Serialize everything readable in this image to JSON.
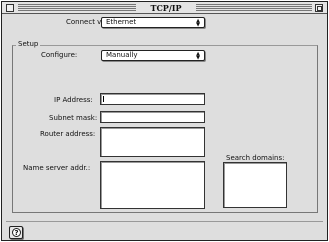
{
  "window": {
    "title": "TCP/IP"
  },
  "connect": {
    "label": "Connect via:",
    "value": "Ethernet"
  },
  "setup": {
    "group_label": "Setup",
    "configure_label": "Configure:",
    "configure_value": "Manually",
    "ip_label": "IP Address:",
    "ip_value": "",
    "subnet_label": "Subnet mask:",
    "subnet_value": "",
    "router_label": "Router address:",
    "router_value": "",
    "nameserver_label": "Name server addr.:",
    "nameserver_value": "",
    "search_domains_label": "Search domains:",
    "search_domains_value": ""
  },
  "footer": {
    "help_glyph": "?"
  },
  "icons": {
    "popup_arrows": "up-down-arrows-icon",
    "help": "help-icon"
  }
}
